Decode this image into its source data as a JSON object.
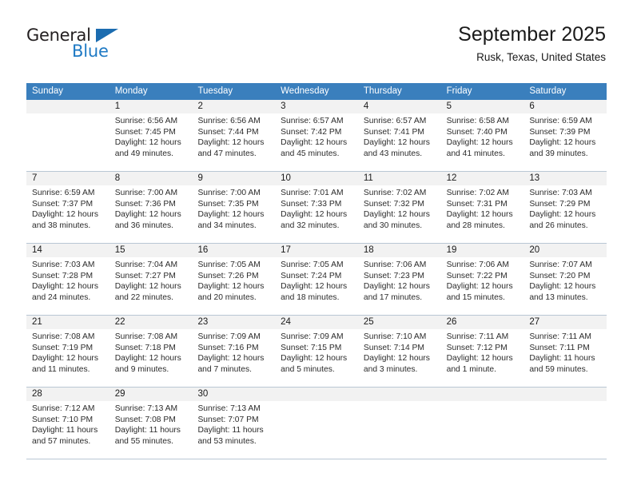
{
  "brand": {
    "name_top": "General",
    "name_bottom": "Blue",
    "accent_color": "#1f7ac4",
    "triangle_color": "#1b6cb0"
  },
  "header": {
    "title": "September 2025",
    "subtitle": "Rusk, Texas, United States"
  },
  "theme": {
    "header_bar": "#3a7fbd",
    "daynum_band": "#f2f2f2",
    "grid_line": "#b9c7d4"
  },
  "weekdays": [
    "Sunday",
    "Monday",
    "Tuesday",
    "Wednesday",
    "Thursday",
    "Friday",
    "Saturday"
  ],
  "labels": {
    "sunrise": "Sunrise:",
    "sunset": "Sunset:",
    "daylight": "Daylight:"
  },
  "weeks": [
    [
      {
        "day": "",
        "sunrise": "",
        "sunset": "",
        "daylight_line1": "",
        "daylight_line2": ""
      },
      {
        "day": "1",
        "sunrise": "Sunrise: 6:56 AM",
        "sunset": "Sunset: 7:45 PM",
        "daylight_line1": "Daylight: 12 hours",
        "daylight_line2": "and 49 minutes."
      },
      {
        "day": "2",
        "sunrise": "Sunrise: 6:56 AM",
        "sunset": "Sunset: 7:44 PM",
        "daylight_line1": "Daylight: 12 hours",
        "daylight_line2": "and 47 minutes."
      },
      {
        "day": "3",
        "sunrise": "Sunrise: 6:57 AM",
        "sunset": "Sunset: 7:42 PM",
        "daylight_line1": "Daylight: 12 hours",
        "daylight_line2": "and 45 minutes."
      },
      {
        "day": "4",
        "sunrise": "Sunrise: 6:57 AM",
        "sunset": "Sunset: 7:41 PM",
        "daylight_line1": "Daylight: 12 hours",
        "daylight_line2": "and 43 minutes."
      },
      {
        "day": "5",
        "sunrise": "Sunrise: 6:58 AM",
        "sunset": "Sunset: 7:40 PM",
        "daylight_line1": "Daylight: 12 hours",
        "daylight_line2": "and 41 minutes."
      },
      {
        "day": "6",
        "sunrise": "Sunrise: 6:59 AM",
        "sunset": "Sunset: 7:39 PM",
        "daylight_line1": "Daylight: 12 hours",
        "daylight_line2": "and 39 minutes."
      }
    ],
    [
      {
        "day": "7",
        "sunrise": "Sunrise: 6:59 AM",
        "sunset": "Sunset: 7:37 PM",
        "daylight_line1": "Daylight: 12 hours",
        "daylight_line2": "and 38 minutes."
      },
      {
        "day": "8",
        "sunrise": "Sunrise: 7:00 AM",
        "sunset": "Sunset: 7:36 PM",
        "daylight_line1": "Daylight: 12 hours",
        "daylight_line2": "and 36 minutes."
      },
      {
        "day": "9",
        "sunrise": "Sunrise: 7:00 AM",
        "sunset": "Sunset: 7:35 PM",
        "daylight_line1": "Daylight: 12 hours",
        "daylight_line2": "and 34 minutes."
      },
      {
        "day": "10",
        "sunrise": "Sunrise: 7:01 AM",
        "sunset": "Sunset: 7:33 PM",
        "daylight_line1": "Daylight: 12 hours",
        "daylight_line2": "and 32 minutes."
      },
      {
        "day": "11",
        "sunrise": "Sunrise: 7:02 AM",
        "sunset": "Sunset: 7:32 PM",
        "daylight_line1": "Daylight: 12 hours",
        "daylight_line2": "and 30 minutes."
      },
      {
        "day": "12",
        "sunrise": "Sunrise: 7:02 AM",
        "sunset": "Sunset: 7:31 PM",
        "daylight_line1": "Daylight: 12 hours",
        "daylight_line2": "and 28 minutes."
      },
      {
        "day": "13",
        "sunrise": "Sunrise: 7:03 AM",
        "sunset": "Sunset: 7:29 PM",
        "daylight_line1": "Daylight: 12 hours",
        "daylight_line2": "and 26 minutes."
      }
    ],
    [
      {
        "day": "14",
        "sunrise": "Sunrise: 7:03 AM",
        "sunset": "Sunset: 7:28 PM",
        "daylight_line1": "Daylight: 12 hours",
        "daylight_line2": "and 24 minutes."
      },
      {
        "day": "15",
        "sunrise": "Sunrise: 7:04 AM",
        "sunset": "Sunset: 7:27 PM",
        "daylight_line1": "Daylight: 12 hours",
        "daylight_line2": "and 22 minutes."
      },
      {
        "day": "16",
        "sunrise": "Sunrise: 7:05 AM",
        "sunset": "Sunset: 7:26 PM",
        "daylight_line1": "Daylight: 12 hours",
        "daylight_line2": "and 20 minutes."
      },
      {
        "day": "17",
        "sunrise": "Sunrise: 7:05 AM",
        "sunset": "Sunset: 7:24 PM",
        "daylight_line1": "Daylight: 12 hours",
        "daylight_line2": "and 18 minutes."
      },
      {
        "day": "18",
        "sunrise": "Sunrise: 7:06 AM",
        "sunset": "Sunset: 7:23 PM",
        "daylight_line1": "Daylight: 12 hours",
        "daylight_line2": "and 17 minutes."
      },
      {
        "day": "19",
        "sunrise": "Sunrise: 7:06 AM",
        "sunset": "Sunset: 7:22 PM",
        "daylight_line1": "Daylight: 12 hours",
        "daylight_line2": "and 15 minutes."
      },
      {
        "day": "20",
        "sunrise": "Sunrise: 7:07 AM",
        "sunset": "Sunset: 7:20 PM",
        "daylight_line1": "Daylight: 12 hours",
        "daylight_line2": "and 13 minutes."
      }
    ],
    [
      {
        "day": "21",
        "sunrise": "Sunrise: 7:08 AM",
        "sunset": "Sunset: 7:19 PM",
        "daylight_line1": "Daylight: 12 hours",
        "daylight_line2": "and 11 minutes."
      },
      {
        "day": "22",
        "sunrise": "Sunrise: 7:08 AM",
        "sunset": "Sunset: 7:18 PM",
        "daylight_line1": "Daylight: 12 hours",
        "daylight_line2": "and 9 minutes."
      },
      {
        "day": "23",
        "sunrise": "Sunrise: 7:09 AM",
        "sunset": "Sunset: 7:16 PM",
        "daylight_line1": "Daylight: 12 hours",
        "daylight_line2": "and 7 minutes."
      },
      {
        "day": "24",
        "sunrise": "Sunrise: 7:09 AM",
        "sunset": "Sunset: 7:15 PM",
        "daylight_line1": "Daylight: 12 hours",
        "daylight_line2": "and 5 minutes."
      },
      {
        "day": "25",
        "sunrise": "Sunrise: 7:10 AM",
        "sunset": "Sunset: 7:14 PM",
        "daylight_line1": "Daylight: 12 hours",
        "daylight_line2": "and 3 minutes."
      },
      {
        "day": "26",
        "sunrise": "Sunrise: 7:11 AM",
        "sunset": "Sunset: 7:12 PM",
        "daylight_line1": "Daylight: 12 hours",
        "daylight_line2": "and 1 minute."
      },
      {
        "day": "27",
        "sunrise": "Sunrise: 7:11 AM",
        "sunset": "Sunset: 7:11 PM",
        "daylight_line1": "Daylight: 11 hours",
        "daylight_line2": "and 59 minutes."
      }
    ],
    [
      {
        "day": "28",
        "sunrise": "Sunrise: 7:12 AM",
        "sunset": "Sunset: 7:10 PM",
        "daylight_line1": "Daylight: 11 hours",
        "daylight_line2": "and 57 minutes."
      },
      {
        "day": "29",
        "sunrise": "Sunrise: 7:13 AM",
        "sunset": "Sunset: 7:08 PM",
        "daylight_line1": "Daylight: 11 hours",
        "daylight_line2": "and 55 minutes."
      },
      {
        "day": "30",
        "sunrise": "Sunrise: 7:13 AM",
        "sunset": "Sunset: 7:07 PM",
        "daylight_line1": "Daylight: 11 hours",
        "daylight_line2": "and 53 minutes."
      },
      {
        "day": "",
        "sunrise": "",
        "sunset": "",
        "daylight_line1": "",
        "daylight_line2": ""
      },
      {
        "day": "",
        "sunrise": "",
        "sunset": "",
        "daylight_line1": "",
        "daylight_line2": ""
      },
      {
        "day": "",
        "sunrise": "",
        "sunset": "",
        "daylight_line1": "",
        "daylight_line2": ""
      },
      {
        "day": "",
        "sunrise": "",
        "sunset": "",
        "daylight_line1": "",
        "daylight_line2": ""
      }
    ]
  ]
}
